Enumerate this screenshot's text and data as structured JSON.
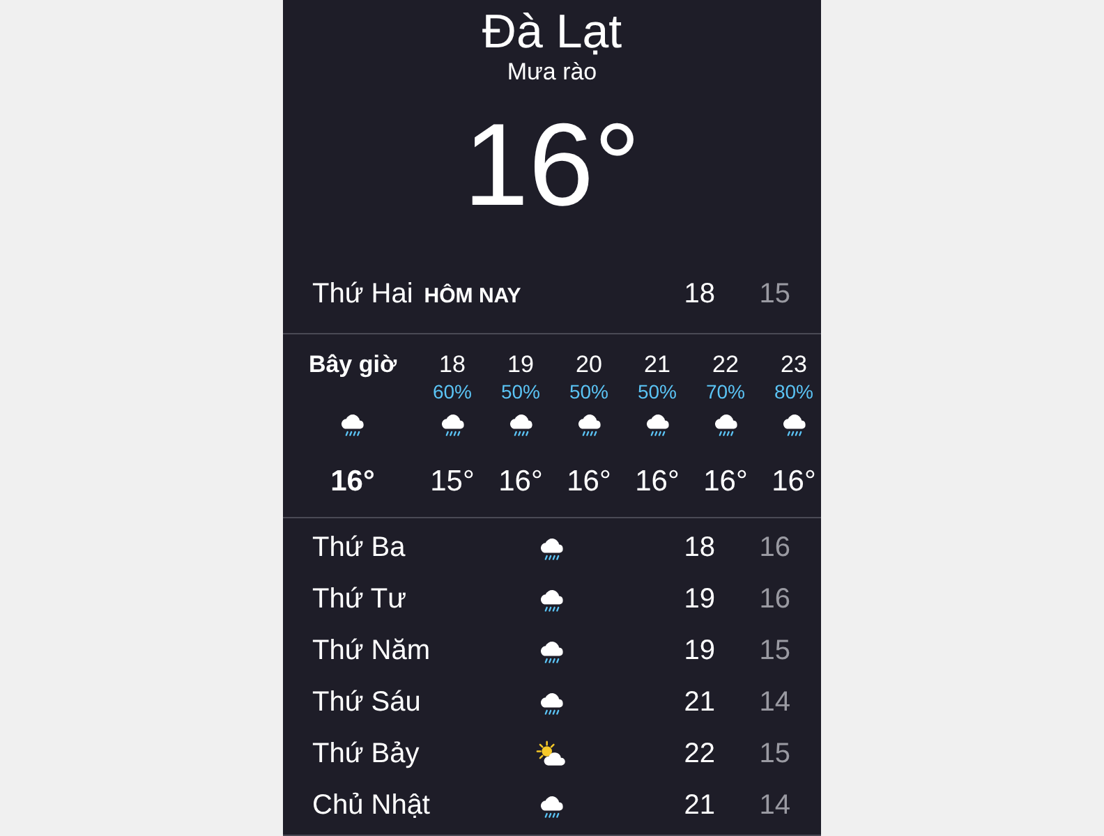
{
  "location": {
    "city": "Đà Lạt",
    "condition": "Mưa rào",
    "temperature": "16°"
  },
  "today": {
    "day": "Thứ Hai",
    "label": "HÔM NAY",
    "high": "18",
    "low": "15"
  },
  "hourly": [
    {
      "time": "Bây giờ",
      "now": true,
      "kind": "rain",
      "temp": "16°"
    },
    {
      "time": "18",
      "chance": "60%",
      "now": false,
      "kind": "rain",
      "temp": "15°"
    },
    {
      "time": "19",
      "chance": "50%",
      "now": false,
      "kind": "rain",
      "temp": "16°"
    },
    {
      "time": "20",
      "chance": "50%",
      "now": false,
      "kind": "rain",
      "temp": "16°"
    },
    {
      "time": "21",
      "chance": "50%",
      "now": false,
      "kind": "rain",
      "temp": "16°"
    },
    {
      "time": "22",
      "chance": "70%",
      "now": false,
      "kind": "rain",
      "temp": "16°"
    },
    {
      "time": "23",
      "chance": "80%",
      "now": false,
      "kind": "rain",
      "temp": "16°"
    }
  ],
  "daily": [
    {
      "day": "Thứ Ba",
      "kind": "rain",
      "high": "18",
      "low": "16"
    },
    {
      "day": "Thứ Tư",
      "kind": "rain",
      "high": "19",
      "low": "16"
    },
    {
      "day": "Thứ Năm",
      "kind": "rain",
      "high": "19",
      "low": "15"
    },
    {
      "day": "Thứ Sáu",
      "kind": "rain",
      "high": "21",
      "low": "14"
    },
    {
      "day": "Thứ Bảy",
      "kind": "partly-sunny",
      "high": "22",
      "low": "15"
    },
    {
      "day": "Chủ Nhật",
      "kind": "rain",
      "high": "21",
      "low": "14"
    }
  ]
}
